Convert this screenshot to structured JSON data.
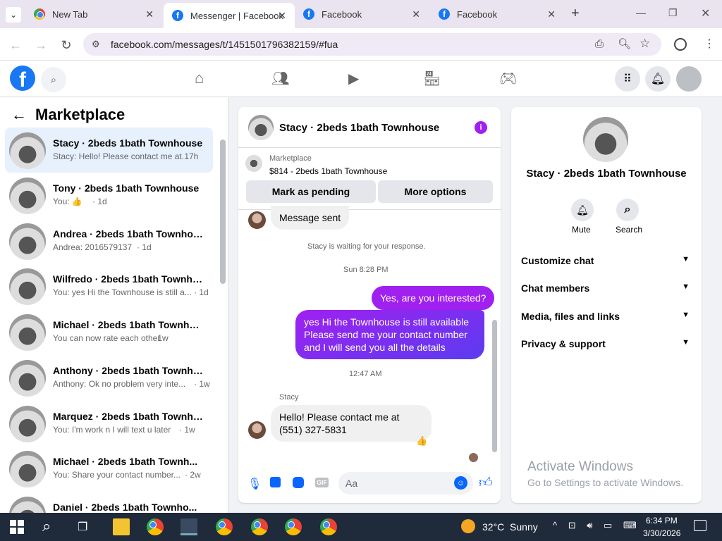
{
  "browser": {
    "tabs": [
      {
        "title": "New Tab",
        "active": false
      },
      {
        "title": "Messenger | Facebook",
        "active": true
      },
      {
        "title": "Facebook",
        "active": false
      },
      {
        "title": "Facebook",
        "active": false
      }
    ],
    "new_tab_label": "+",
    "url": "facebook.com/messages/t/1451501796382159/#fua"
  },
  "fb_header": {
    "logo": "f",
    "search_placeholder": ""
  },
  "left_panel": {
    "title": "Marketplace",
    "conversations": [
      {
        "name": "Stacy · 2beds 1bath Townhouse",
        "preview": "Stacy: Hello! Please contact me at...",
        "time": "· 17h",
        "selected": true
      },
      {
        "name": "Tony · 2beds 1bath Townhouse",
        "preview": "You: 👍",
        "time": "· 1d"
      },
      {
        "name": "Andrea · 2beds 1bath Townhouse",
        "preview": "Andrea: 2016579137",
        "time": "· 1d"
      },
      {
        "name": "Wilfredo · 2beds 1bath Townhou...",
        "preview": "You: yes Hi the Townhouse is still a...",
        "time": "· 1d"
      },
      {
        "name": "Michael · 2beds 1bath Townhouse",
        "preview": "You can now rate each other",
        "time": "· 1w"
      },
      {
        "name": "Anthony · 2beds 1bath Townhou...",
        "preview": "Anthony: Ok no problem very inte...",
        "time": "· 1w"
      },
      {
        "name": "Marquez · 2beds 1bath Townho...",
        "preview": "You: I'm work n I will text u later",
        "time": "· 1w"
      },
      {
        "name": "Michael · 2beds 1bath Townh...",
        "preview": "You: Share your contact number...",
        "time": "· 2w"
      },
      {
        "name": "Daniel · 2beds 1bath Townho...",
        "preview": "",
        "time": ""
      }
    ]
  },
  "chat": {
    "header_name": "Stacy · 2beds 1bath Townhouse",
    "listing_label": "Marketplace",
    "listing_title": "$814 - 2beds 1bath Townhouse",
    "mark_pending": "Mark as pending",
    "more_options": "More options",
    "msg_sent": "Message sent",
    "waiting": "Stacy is waiting for your response.",
    "ts1": "Sun 8:28 PM",
    "out1": "Yes, are you interested?",
    "out2": "yes Hi the Townhouse is still available Please send me your contact number and I will send you all the details",
    "ts2": "12:47 AM",
    "sender": "Stacy",
    "in1": "Hello! Please contact me at (551) 327-5831",
    "reaction": "👍",
    "composer_placeholder": "Aa"
  },
  "right_panel": {
    "name": "Stacy · 2beds 1bath Townhouse",
    "mute": "Mute",
    "search": "Search",
    "sections": [
      "Customize chat",
      "Chat members",
      "Media, files and links",
      "Privacy & support"
    ]
  },
  "watermark": {
    "line1": "Activate Windows",
    "line2": "Go to Settings to activate Windows."
  },
  "taskbar": {
    "weather": "32°C  Sunny",
    "time": "6:34 PM",
    "date": "3/30/2026"
  },
  "colors": {
    "fb_blue": "#1877f2",
    "accent_purple": "#a020f0",
    "taskbar": "#1f2a3a"
  }
}
